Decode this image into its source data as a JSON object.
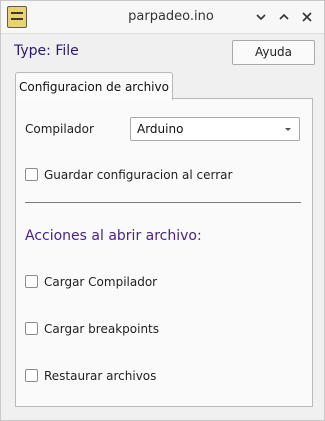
{
  "window": {
    "title": "parpadeo.ino",
    "icon": "arduino-sketch-icon",
    "controls": [
      "minimize-icon",
      "maximize-icon",
      "close-icon"
    ]
  },
  "header": {
    "type_label": "Type: File",
    "help_button": "Ayuda"
  },
  "tabs": [
    {
      "label": "Configuracion de archivo",
      "selected": true
    }
  ],
  "config": {
    "compiler_label": "Compilador",
    "compiler_value": "Arduino",
    "save_on_close_label": "Guardar configuracion al cerrar",
    "save_on_close_checked": false
  },
  "actions": {
    "title": "Acciones al abrir archivo:",
    "items": [
      {
        "label": "Cargar Compilador",
        "checked": false
      },
      {
        "label": "Cargar breakpoints",
        "checked": false
      },
      {
        "label": "Restaurar archivos",
        "checked": false
      }
    ]
  }
}
